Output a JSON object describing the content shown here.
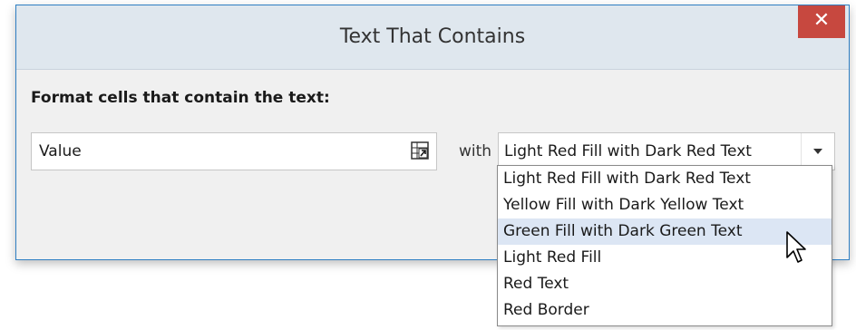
{
  "window": {
    "title": "Text That Contains",
    "close_label": "✕"
  },
  "form": {
    "heading": "Format cells that contain the text:",
    "value_field": "Value",
    "with_label": "with",
    "format_selected": "Light Red Fill with Dark Red Text"
  },
  "dropdown": {
    "options": [
      "Light Red Fill with Dark Red Text",
      "Yellow Fill with Dark Yellow Text",
      "Green Fill with Dark Green Text",
      "Light Red Fill",
      "Red Text",
      "Red Border"
    ],
    "hovered_option": "Green Fill with Dark Green Text"
  },
  "colors": {
    "title_bar": "#dfe7ee",
    "close_button": "#c7483f",
    "dialog_border": "#2f7fc3",
    "hover_highlight": "#dce6f4"
  },
  "icons": {
    "value_picker": "cell-reference-icon",
    "combo": "chevron-down-icon",
    "pointer": "mouse-cursor-icon"
  }
}
